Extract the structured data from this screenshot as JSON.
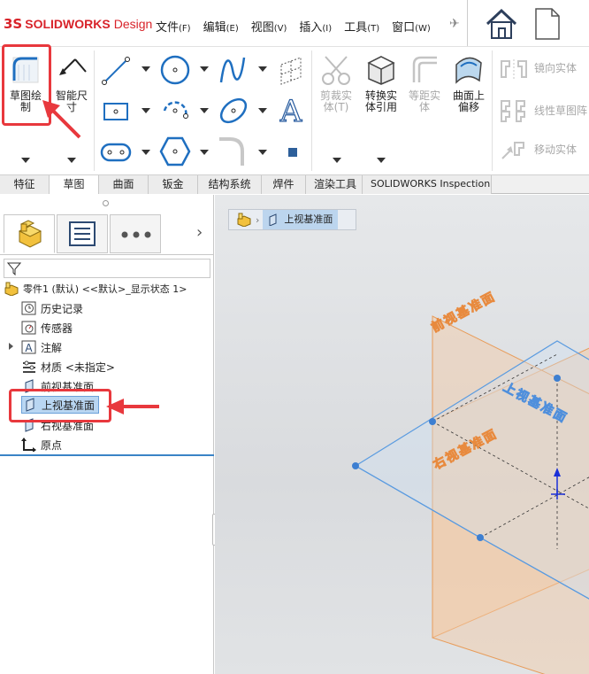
{
  "titlebar": {
    "logo_ds": "3S",
    "brand": "SOLIDWORKS",
    "design": "Design",
    "menu": [
      {
        "label": "文件",
        "accel": "(F)"
      },
      {
        "label": "编辑",
        "accel": "(E)"
      },
      {
        "label": "视图",
        "accel": "(V)"
      },
      {
        "label": "插入",
        "accel": "(I)"
      },
      {
        "label": "工具",
        "accel": "(T)"
      },
      {
        "label": "窗口",
        "accel": "(W)"
      }
    ],
    "pin_icon": "pin-icon",
    "home_icon": "home-icon",
    "new_document_icon": "new-document-icon"
  },
  "ribbon": {
    "sketch": {
      "label_1": "草图绘",
      "label_2": "制",
      "icon": "sketch-icon"
    },
    "smart_dimension": {
      "label_1": "智能尺",
      "label_2": "寸",
      "icon": "smart-dimension-icon"
    },
    "trim": {
      "label_1": "剪裁实",
      "label_2": "体(T)"
    },
    "convert": {
      "label_1": "转换实",
      "label_2": "体引用"
    },
    "offset": {
      "label_1": "等距实",
      "label_2": "体"
    },
    "offset_surface": {
      "label_1": "曲面上",
      "label_2": "偏移"
    },
    "mirror": "镜向实体",
    "linear_pattern": "线性草图阵",
    "move": "移动实体"
  },
  "tabs": [
    {
      "label": "特征"
    },
    {
      "label": "草图",
      "active": true
    },
    {
      "label": "曲面"
    },
    {
      "label": "钣金"
    },
    {
      "label": "结构系统"
    },
    {
      "label": "焊件"
    },
    {
      "label": "渲染工具"
    },
    {
      "label": "SOLIDWORKS Inspection"
    }
  ],
  "feature_manager": {
    "expand_arrow": "›",
    "tree": {
      "root": "零件1 (默认) <<默认>_显示状态 1>",
      "history": "历史记录",
      "sensors": "传感器",
      "annotations": "注解",
      "material": "材质 <未指定>",
      "front_plane": "前视基准面",
      "top_plane": "上视基准面",
      "right_plane": "右视基准面",
      "origin": "原点"
    }
  },
  "viewport": {
    "breadcrumb": "上视基准面",
    "plane_front": "前视基准面",
    "plane_top": "上视基准面",
    "plane_right": "右视基准面"
  },
  "colors": {
    "accent_red": "#e8383d",
    "plane_orange": "#f0a86a",
    "plane_blue": "#5a9be0",
    "selection": "#b9d6f2"
  }
}
